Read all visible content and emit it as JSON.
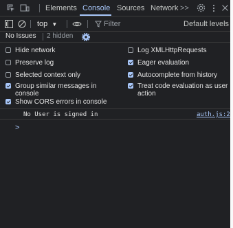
{
  "tabs": {
    "elements": "Elements",
    "console": "Console",
    "sources": "Sources",
    "network": "Network",
    "more": ">>"
  },
  "toolbar": {
    "context": "top",
    "filter_placeholder": "Filter",
    "levels": "Default levels"
  },
  "issues": {
    "label": "No Issues",
    "hidden": "2 hidden"
  },
  "settings": {
    "hide_network": "Hide network",
    "preserve_log": "Preserve log",
    "selected_context": "Selected context only",
    "group_similar": "Group similar messages in console",
    "show_cors": "Show CORS errors in console",
    "log_xhr": "Log XMLHttpRequests",
    "eager_eval": "Eager evaluation",
    "autocomplete": "Autocomplete from history",
    "treat_code": "Treat code evaluation as user action"
  },
  "console": {
    "message": "No User is signed in",
    "source": "auth.js:20",
    "prompt": ">"
  },
  "colors": {
    "background": "#202124",
    "accent": "#a8c7fa",
    "text": "#e3e3e3"
  }
}
